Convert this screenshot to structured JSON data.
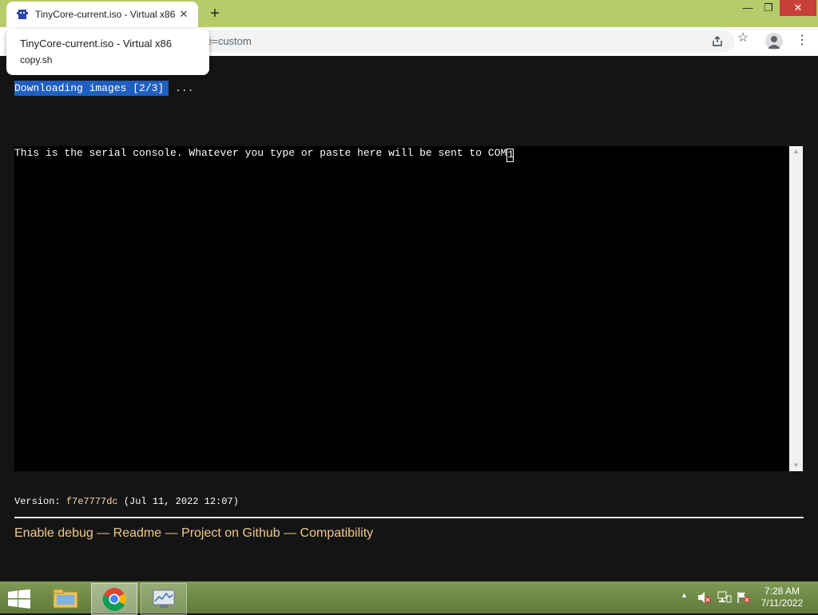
{
  "browser": {
    "tab_title": "TinyCore-current.iso - Virtual x86",
    "tab_close": "✕",
    "new_tab": "+",
    "window_min": "—",
    "window_max": "❐",
    "window_close": "✕",
    "url_fragment": "e=custom",
    "menu_dots": "⋮"
  },
  "tooltip": {
    "title": "TinyCore-current.iso - Virtual x86",
    "subtitle": "copy.sh"
  },
  "page": {
    "status_highlight": "Downloading images [2/3]",
    "status_suffix": " ...",
    "console_text": "This is the serial console. Whatever you type or paste here will be sent to COM",
    "console_cursor_char": "1",
    "version_label": "Version: ",
    "version_hash": "f7e7777dc",
    "version_date": " (Jul 11, 2022 12:07)",
    "links": [
      {
        "label": "Enable debug"
      },
      {
        "label": "Readme"
      },
      {
        "label": "Project on Github"
      },
      {
        "label": "Compatibility"
      }
    ],
    "link_separator": " — "
  },
  "taskbar": {
    "tray_up": "▲",
    "clock_time": "7:28 AM",
    "clock_date": "7/11/2022"
  },
  "colors": {
    "titlebar": "#b6cc6a",
    "page_bg": "#141414",
    "highlight": "#1f5fc2",
    "link": "#f3c987"
  }
}
